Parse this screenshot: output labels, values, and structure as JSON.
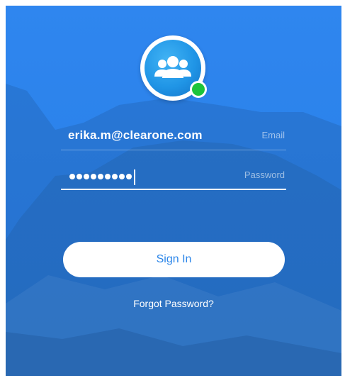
{
  "app": {
    "logo_icon": "people-group-icon",
    "status_indicator": "online-status-icon",
    "colors": {
      "background": "#2b82ea",
      "accent": "#2c86e9",
      "status_online": "#1cc43b",
      "text": "#ffffff"
    }
  },
  "login": {
    "email": {
      "value": "erika.m@clearone.com",
      "placeholder": "Email"
    },
    "password": {
      "masked_length": 9,
      "placeholder": "Password"
    },
    "sign_in_label": "Sign In",
    "forgot_label": "Forgot Password?"
  }
}
